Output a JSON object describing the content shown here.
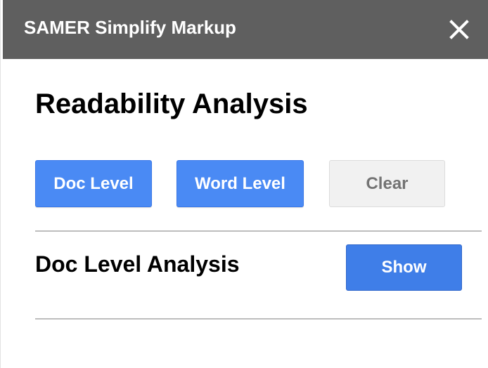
{
  "dialog": {
    "title": "SAMER Simplify Markup",
    "close_icon": "close-icon"
  },
  "main": {
    "heading": "Readability Analysis",
    "buttons": {
      "doc_level": "Doc Level",
      "word_level": "Word Level",
      "clear": "Clear"
    },
    "doc_analysis": {
      "label": "Doc Level Analysis",
      "show_button": "Show"
    }
  },
  "colors": {
    "titlebar": "#5f5f5f",
    "primary_button": "#4a8af4",
    "secondary_button": "#f1f1f1"
  }
}
